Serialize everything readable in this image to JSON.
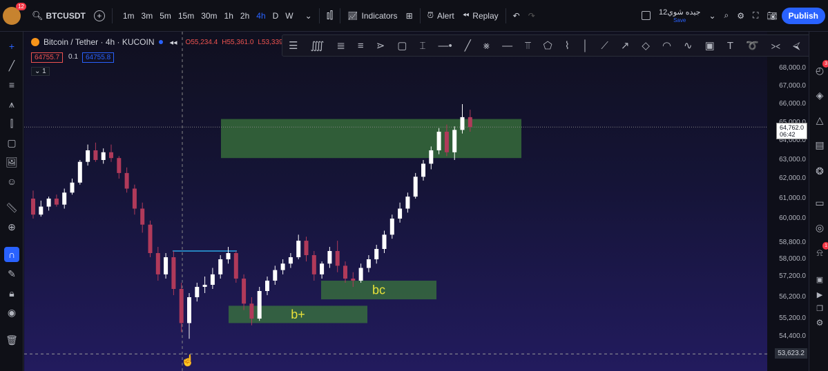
{
  "topbar": {
    "avatar_badge": "12",
    "symbol": "BTCUSDT",
    "timeframes": [
      {
        "label": "1m",
        "active": false
      },
      {
        "label": "3m",
        "active": false
      },
      {
        "label": "5m",
        "active": false
      },
      {
        "label": "15m",
        "active": false
      },
      {
        "label": "30m",
        "active": false
      },
      {
        "label": "1h",
        "active": false
      },
      {
        "label": "2h",
        "active": false
      },
      {
        "label": "4h",
        "active": true
      },
      {
        "label": "D",
        "active": false
      },
      {
        "label": "W",
        "active": false
      }
    ],
    "indicators_label": "Indicators",
    "alert_label": "Alert",
    "replay_label": "Replay",
    "layout_name": "جيده شوي12",
    "save_label": "Save",
    "publish_label": "Publish"
  },
  "legend": {
    "title": "Bitcoin / Tether · 4h · KUCOIN",
    "open": "O55,234.4",
    "high": "H55,361.0",
    "low": "L53,339",
    "bid": "64755.7",
    "spread": "0.1",
    "ask": "64755.8",
    "indicator_count": "1"
  },
  "price_axis": {
    "ticks": [
      "68,000.0",
      "67,000.0",
      "66,000.0",
      "65,000.0",
      "64,000.0",
      "63,000.0",
      "62,000.0",
      "61,000.0",
      "60,000.0",
      "58,800.0",
      "58,000.0",
      "57,200.0",
      "56,200.0",
      "55,200.0",
      "54,400.0"
    ],
    "last_price": "64,762.0",
    "countdown": "06:42",
    "cursor_price": "53,623.2"
  },
  "zones": [
    {
      "label": "",
      "color": "#3c7a3c"
    },
    {
      "label": "bc",
      "color": "#3c7a3c"
    },
    {
      "label": "b+",
      "color": "#3c7a3c"
    }
  ],
  "right_badges": {
    "clock": "3",
    "bell": "1"
  },
  "colors": {
    "accent": "#2962ff",
    "up": "#ffffff",
    "down": "#b03a5a",
    "zone_text": "#e8e13a"
  },
  "chart_data": {
    "type": "candlestick",
    "series": [
      {
        "values": [
          [
            61000,
            61400,
            60000,
            60200
          ],
          [
            60200,
            60900,
            60100,
            60600
          ],
          [
            60600,
            61100,
            60400,
            61000
          ],
          [
            61000,
            61200,
            60600,
            60700
          ],
          [
            60700,
            61500,
            60500,
            61300
          ],
          [
            61300,
            62000,
            61200,
            61800
          ],
          [
            61800,
            63000,
            61700,
            62900
          ],
          [
            62900,
            63800,
            62700,
            63500
          ],
          [
            63500,
            63900,
            62900,
            63000
          ],
          [
            63000,
            63600,
            62800,
            63400
          ],
          [
            63400,
            63800,
            62900,
            63100
          ],
          [
            63100,
            63200,
            62000,
            62300
          ],
          [
            62300,
            62600,
            61300,
            61500
          ],
          [
            61500,
            61700,
            60200,
            60500
          ],
          [
            60500,
            60800,
            59300,
            59700
          ],
          [
            59700,
            59900,
            58100,
            58300
          ],
          [
            58300,
            58600,
            57000,
            57300
          ],
          [
            57300,
            58300,
            57100,
            58100
          ],
          [
            58100,
            58400,
            56300,
            56600
          ],
          [
            56600,
            56900,
            54600,
            55000
          ],
          [
            55000,
            56400,
            54300,
            56200
          ],
          [
            56200,
            56900,
            56000,
            56700
          ],
          [
            56700,
            57200,
            56400,
            56800
          ],
          [
            56800,
            57600,
            56600,
            57300
          ],
          [
            57300,
            58200,
            57100,
            58000
          ],
          [
            58000,
            58600,
            57800,
            58300
          ],
          [
            58300,
            58400,
            56900,
            57100
          ],
          [
            57100,
            57300,
            55600,
            55900
          ],
          [
            55900,
            56200,
            54900,
            55200
          ],
          [
            55200,
            56700,
            55100,
            56500
          ],
          [
            56500,
            57200,
            56300,
            57000
          ],
          [
            57000,
            57700,
            56800,
            57500
          ],
          [
            57500,
            58000,
            57300,
            57800
          ],
          [
            57800,
            58300,
            57600,
            58100
          ],
          [
            58100,
            59200,
            58000,
            58900
          ],
          [
            58900,
            59100,
            57900,
            58200
          ],
          [
            58200,
            58400,
            57000,
            57300
          ],
          [
            57300,
            57900,
            57100,
            57800
          ],
          [
            57800,
            58600,
            57600,
            58400
          ],
          [
            58400,
            58900,
            57400,
            57700
          ],
          [
            57700,
            57900,
            56900,
            57100
          ],
          [
            57100,
            57400,
            56700,
            57000
          ],
          [
            57000,
            57800,
            56900,
            57600
          ],
          [
            57600,
            58200,
            57400,
            58000
          ],
          [
            58000,
            58700,
            57800,
            58500
          ],
          [
            58500,
            59400,
            58300,
            59200
          ],
          [
            59200,
            60200,
            59000,
            60000
          ],
          [
            60000,
            60800,
            59800,
            60500
          ],
          [
            60500,
            61300,
            60300,
            61100
          ],
          [
            61100,
            62300,
            61000,
            62100
          ],
          [
            62100,
            63000,
            61900,
            62800
          ],
          [
            62800,
            63700,
            62500,
            63500
          ],
          [
            63500,
            64700,
            63300,
            64500
          ],
          [
            64500,
            64900,
            63200,
            63400
          ],
          [
            63400,
            64800,
            63000,
            64600
          ],
          [
            64600,
            66000,
            64400,
            65300
          ],
          [
            65300,
            65700,
            64500,
            64762
          ]
        ]
      }
    ]
  }
}
